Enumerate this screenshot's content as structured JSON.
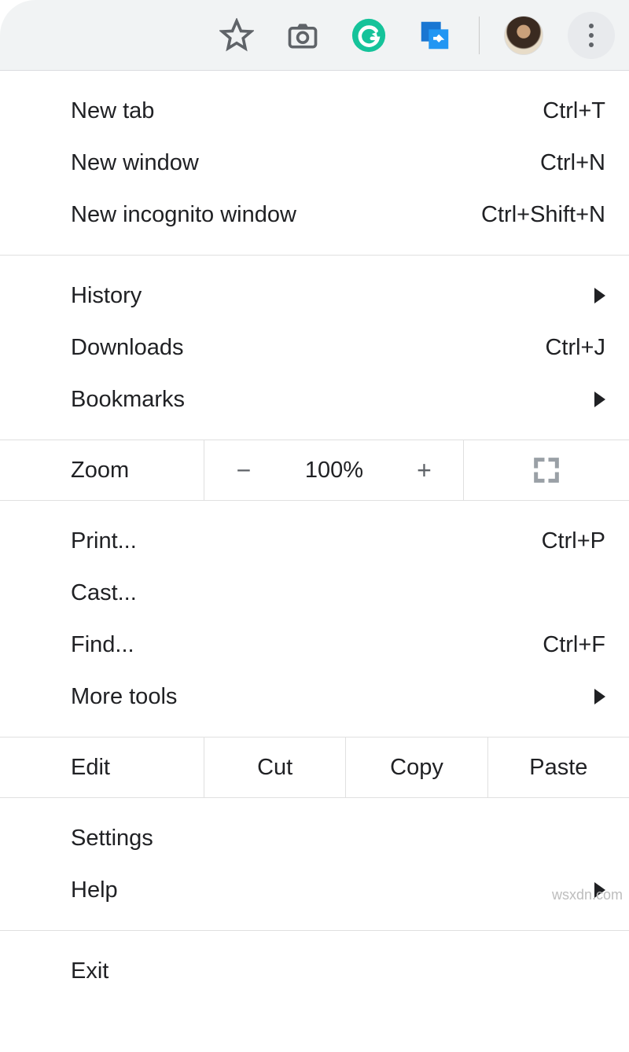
{
  "toolbar": {
    "star_icon": "bookmark-star-icon",
    "camera_icon": "camera-icon",
    "grammarly_icon": "grammarly-icon",
    "export_icon": "share-export-icon",
    "profile": "user-avatar",
    "kebab": "menu-button"
  },
  "menu": {
    "group1": [
      {
        "label": "New tab",
        "shortcut": "Ctrl+T"
      },
      {
        "label": "New window",
        "shortcut": "Ctrl+N"
      },
      {
        "label": "New incognito window",
        "shortcut": "Ctrl+Shift+N"
      }
    ],
    "group2": [
      {
        "label": "History",
        "submenu": true
      },
      {
        "label": "Downloads",
        "shortcut": "Ctrl+J"
      },
      {
        "label": "Bookmarks",
        "submenu": true
      }
    ],
    "zoom": {
      "label": "Zoom",
      "minus": "−",
      "value": "100%",
      "plus": "+"
    },
    "group3": [
      {
        "label": "Print...",
        "shortcut": "Ctrl+P"
      },
      {
        "label": "Cast..."
      },
      {
        "label": "Find...",
        "shortcut": "Ctrl+F"
      },
      {
        "label": "More tools",
        "submenu": true
      }
    ],
    "edit": {
      "label": "Edit",
      "cut": "Cut",
      "copy": "Copy",
      "paste": "Paste"
    },
    "group4": [
      {
        "label": "Settings"
      },
      {
        "label": "Help",
        "submenu": true
      }
    ],
    "group5": [
      {
        "label": "Exit"
      }
    ]
  },
  "watermark": "wsxdn.com"
}
